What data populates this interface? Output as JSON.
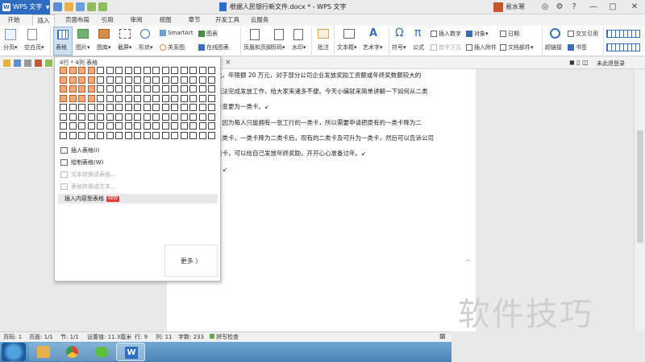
{
  "titlebar": {
    "app_name": "WPS 文字",
    "doc_title": "根据人民银行新文件.docx * - WPS 文字",
    "user_name": "易水寒"
  },
  "tabs": [
    "开始",
    "插入",
    "页面布局",
    "引用",
    "审阅",
    "视图",
    "章节",
    "开发工具",
    "云服务"
  ],
  "active_tab": "插入",
  "ribbon": {
    "paging": "分页",
    "blank_page": "空白页",
    "table": "表格",
    "picture": "图片",
    "gallery": "图库",
    "screenshot": "截屏",
    "shapes": "形状",
    "smartart": "SmartArt",
    "chart": "图表",
    "relation": "关系图",
    "online_chart": "在线图表",
    "header_footer": "页眉和页脚",
    "page_number": "页码",
    "watermark_btn": "水印",
    "comment": "批注",
    "textbox": "文本框",
    "wordart": "艺术字",
    "symbol": "符号",
    "formula": "公式",
    "insert_number": "插入数字",
    "object": "对象",
    "date": "日期",
    "drop_cap": "首字下沉",
    "attachment": "插入附件",
    "doc_part": "文档部件",
    "hyperlink": "超链接",
    "cross_ref": "交叉引用",
    "bookmark": "书签"
  },
  "toolbar2": {
    "right_label": "未此退登录"
  },
  "document": {
    "lines": [
      "元，年限额 20 万元，对于部分公司企业发放奖励工资额或年终奖数额较大的",
      "无法完成发放工作，给大家来诸多不便。今天小编就来简单讲解一下如何从二类",
      "卡变更为一类卡。↙",
      "，因为每人只能拥有一张工行的一类卡，所以需要申请把原有的一类卡降为二",
      "二类卡，一类卡降为二类卡后，现有的二类卡及可升为一类卡，然后可以告诉公司",
      "类卡，可以给自己发放年终奖励，开开心心准备过年。↙",
      "↙"
    ]
  },
  "dropdown": {
    "header": "4行 * 4列 表格",
    "grid_rows": 8,
    "grid_cols": 17,
    "selected_rows": 4,
    "selected_cols": 4,
    "items": [
      {
        "label": "插入表格(I)",
        "enabled": true
      },
      {
        "label": "绘制表格(W)",
        "enabled": true
      },
      {
        "label": "文本转换成表格...",
        "enabled": false
      },
      {
        "label": "表格转换成文本...",
        "enabled": false
      },
      {
        "label": "插入内容型表格",
        "enabled": true,
        "badge": "NEW"
      }
    ],
    "more": "更多 〉"
  },
  "statusbar": {
    "page": "页码: 1",
    "pages": "页面: 1/1",
    "section": "节: 1/1",
    "setting": "设置值: 11.3厘米",
    "row": "行: 9",
    "col": "列: 11",
    "words": "字数: 233",
    "spell": "拼写检查"
  },
  "watermark_text": "软件技巧",
  "colors": {
    "app_blue": "#2d6cc0",
    "grid_selected": "#f4a97a",
    "taskbar": "#4a82b4"
  }
}
